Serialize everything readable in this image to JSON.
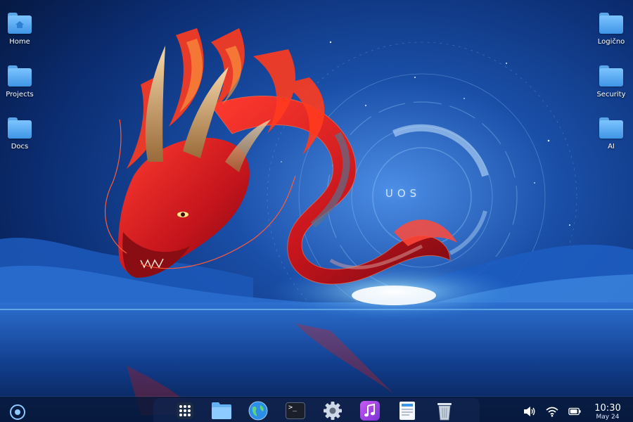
{
  "wallpaper": {
    "brand_text": "UOS"
  },
  "desktop": {
    "left_icons": [
      {
        "label": "Home",
        "icon": "home-folder-icon"
      },
      {
        "label": "Projects",
        "icon": "folder-icon"
      },
      {
        "label": "Docs",
        "icon": "folder-icon"
      }
    ],
    "right_icons": [
      {
        "label": "Logično",
        "icon": "folder-icon"
      },
      {
        "label": "Security",
        "icon": "folder-icon"
      },
      {
        "label": "AI",
        "icon": "folder-icon"
      }
    ]
  },
  "taskbar": {
    "launcher_icon": "launcher-icon",
    "dock": [
      {
        "name": "app-grid",
        "icon": "app-grid-icon"
      },
      {
        "name": "file-manager",
        "icon": "file-manager-icon"
      },
      {
        "name": "browser",
        "icon": "globe-icon"
      },
      {
        "name": "terminal",
        "icon": "terminal-icon"
      },
      {
        "name": "settings",
        "icon": "gear-icon"
      },
      {
        "name": "music",
        "icon": "music-icon"
      },
      {
        "name": "text-editor",
        "icon": "document-icon"
      },
      {
        "name": "trash",
        "icon": "trash-icon"
      }
    ],
    "tray": [
      {
        "name": "volume",
        "icon": "speaker-icon"
      },
      {
        "name": "network",
        "icon": "wifi-icon"
      },
      {
        "name": "battery",
        "icon": "battery-icon"
      }
    ],
    "clock": {
      "time": "10:30",
      "date": "May 24"
    },
    "terminal_glyph": ">_"
  },
  "colors": {
    "accent": "#3f95e6",
    "folder": "#7cc4ff",
    "taskbar": "#08183a"
  }
}
